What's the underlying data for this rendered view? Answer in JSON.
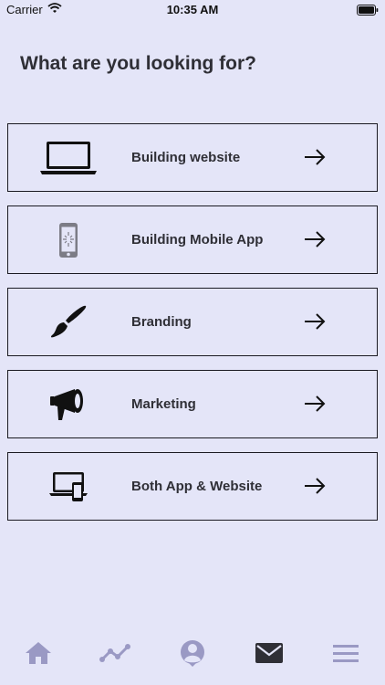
{
  "status_bar": {
    "carrier": "Carrier",
    "time": "10:35 AM"
  },
  "page": {
    "title": "What are you looking for?"
  },
  "options": [
    {
      "label": "Building website",
      "icon": "laptop-icon"
    },
    {
      "label": "Building Mobile App",
      "icon": "mobile-phone-icon"
    },
    {
      "label": "Branding",
      "icon": "paintbrush-icon"
    },
    {
      "label": "Marketing",
      "icon": "megaphone-icon"
    },
    {
      "label": "Both App & Website",
      "icon": "devices-icon"
    }
  ],
  "tab_bar": {
    "tabs": [
      {
        "icon": "home-icon"
      },
      {
        "icon": "activity-chart-icon"
      },
      {
        "icon": "profile-icon"
      },
      {
        "icon": "mail-icon",
        "active": true
      },
      {
        "icon": "menu-icon"
      }
    ]
  },
  "colors": {
    "background": "#e4e5f8",
    "tab_inactive": "#9a99c4",
    "tab_active": "#2f2f36"
  }
}
